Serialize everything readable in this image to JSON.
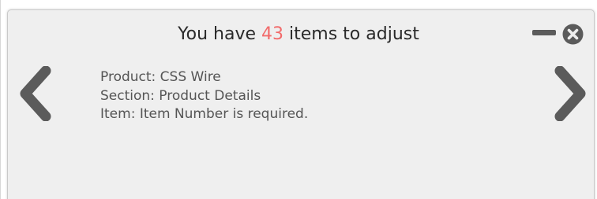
{
  "header": {
    "title_prefix": "You have ",
    "count": "43",
    "title_suffix": " items to adjust"
  },
  "controls": {
    "minimize_icon": "minus-icon",
    "close_icon": "close-circle-icon",
    "prev_icon": "chevron-left-icon",
    "next_icon": "chevron-right-icon"
  },
  "details": {
    "product": "Product: CSS Wire",
    "section": "Section: Product Details",
    "item": "Item: Item Number is required."
  },
  "colors": {
    "count_highlight": "#f26b6b",
    "icon": "#5b5b5b",
    "panel_bg": "#efefef"
  }
}
